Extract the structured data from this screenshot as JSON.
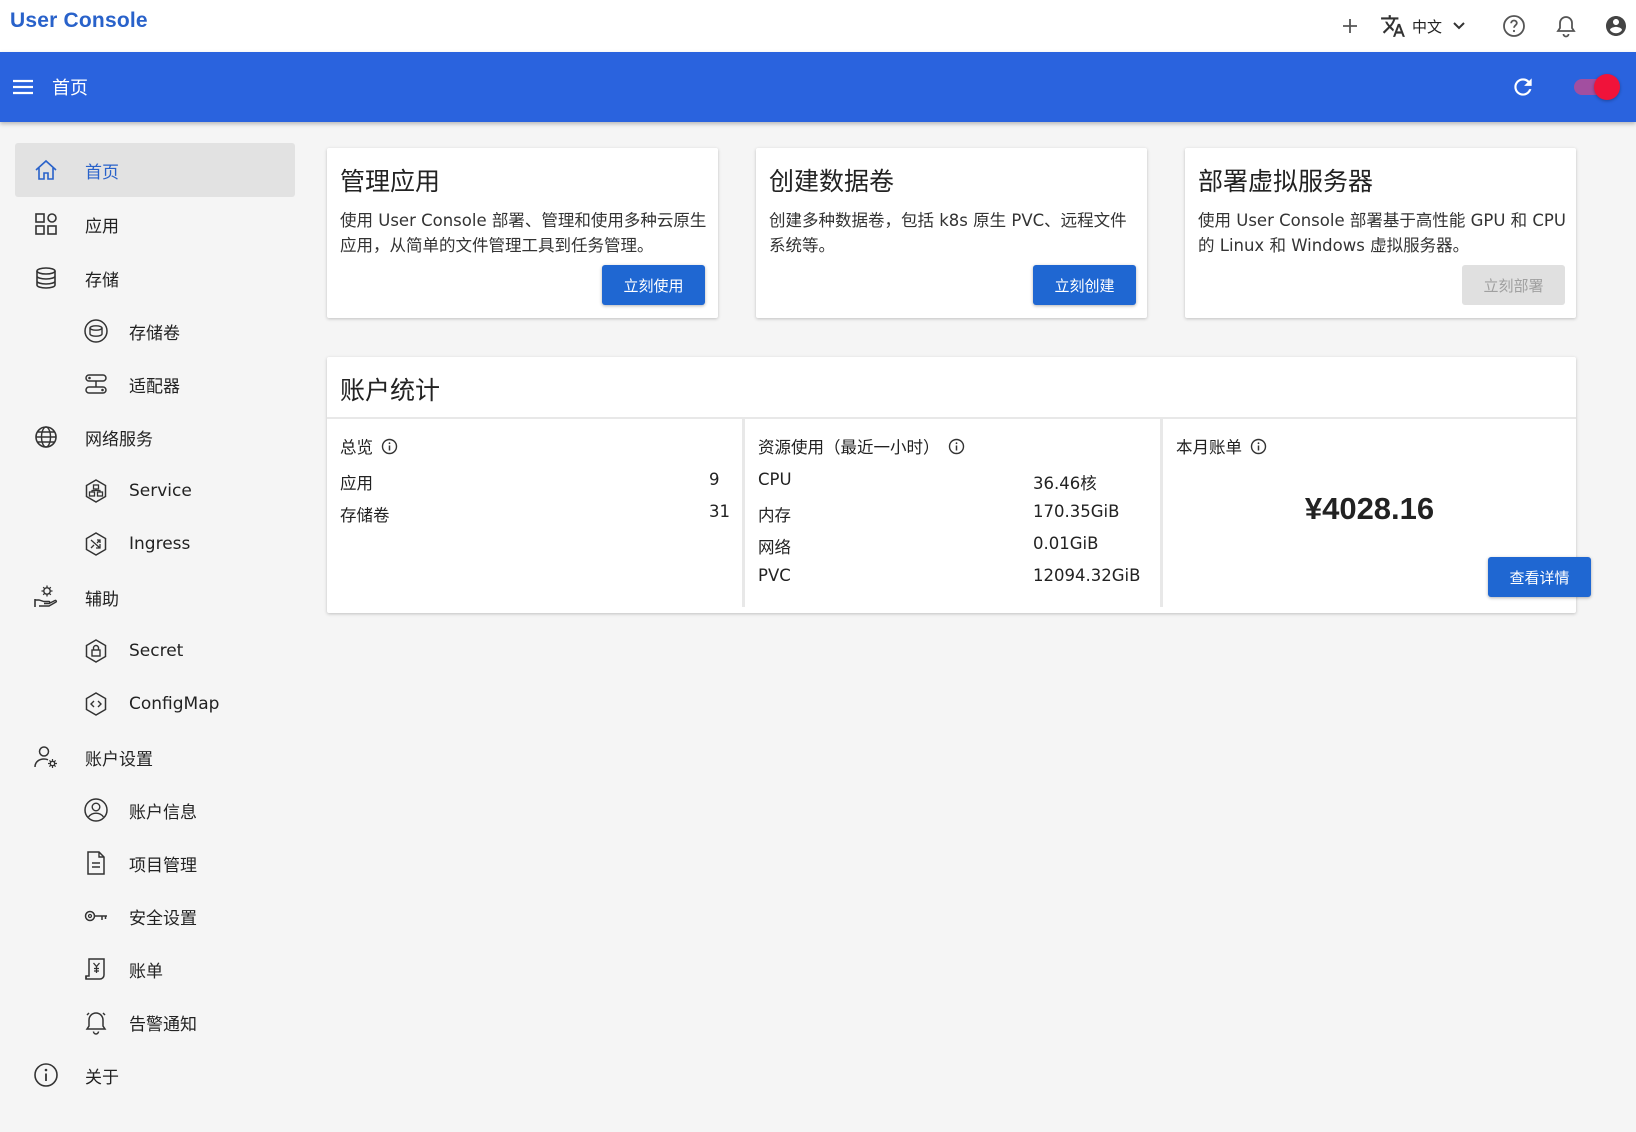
{
  "app": {
    "brand": "User Console"
  },
  "topbar": {
    "language": "中文"
  },
  "bluebar": {
    "title": "首页"
  },
  "sidebar": {
    "items": [
      {
        "label": "首页",
        "icon": "home-icon"
      },
      {
        "label": "应用",
        "icon": "apps-icon"
      },
      {
        "label": "存储",
        "icon": "database-icon"
      },
      {
        "label": "存储卷",
        "icon": "volume-icon"
      },
      {
        "label": "适配器",
        "icon": "adapter-icon"
      },
      {
        "label": "网络服务",
        "icon": "globe-icon"
      },
      {
        "label": "Service",
        "icon": "service-icon"
      },
      {
        "label": "Ingress",
        "icon": "ingress-icon"
      },
      {
        "label": "辅助",
        "icon": "helper-icon"
      },
      {
        "label": "Secret",
        "icon": "lock-icon"
      },
      {
        "label": "ConfigMap",
        "icon": "code-icon"
      },
      {
        "label": "账户设置",
        "icon": "user-gear-icon"
      },
      {
        "label": "账户信息",
        "icon": "account-circle-icon"
      },
      {
        "label": "项目管理",
        "icon": "document-icon"
      },
      {
        "label": "安全设置",
        "icon": "key-icon"
      },
      {
        "label": "账单",
        "icon": "bill-icon"
      },
      {
        "label": "告警通知",
        "icon": "alarm-icon"
      },
      {
        "label": "关于",
        "icon": "info-icon"
      }
    ]
  },
  "cards": [
    {
      "title": "管理应用",
      "desc": "使用 User Console 部署、管理和使用多种云原生应用，从简单的文件管理工具到任务管理。",
      "button": "立刻使用"
    },
    {
      "title": "创建数据卷",
      "desc": "创建多种数据卷，包括 k8s 原生 PVC、远程文件系统等。",
      "button": "立刻创建"
    },
    {
      "title": "部署虚拟服务器",
      "desc": "使用 User Console 部署基于高性能 GPU 和 CPU 的 Linux 和 Windows 虚拟服务器。",
      "button": "立刻部署"
    }
  ],
  "stats": {
    "title": "账户统计",
    "overview": {
      "head": "总览",
      "rows": [
        {
          "label": "应用",
          "value": "9"
        },
        {
          "label": "存储卷",
          "value": "31"
        }
      ]
    },
    "resources": {
      "head": "资源使用（最近一小时）",
      "rows": [
        {
          "label": "CPU",
          "value": "36.46核"
        },
        {
          "label": "内存",
          "value": "170.35GiB"
        },
        {
          "label": "网络",
          "value": "0.01GiB"
        },
        {
          "label": "PVC",
          "value": "12094.32GiB"
        }
      ]
    },
    "bill": {
      "head": "本月账单",
      "amount": "¥4028.16",
      "button": "查看详情"
    }
  },
  "colors": {
    "primary": "#2a63de",
    "brand": "#2962ca",
    "button": "#1f67d2",
    "toggle_knob": "#f0133a"
  }
}
